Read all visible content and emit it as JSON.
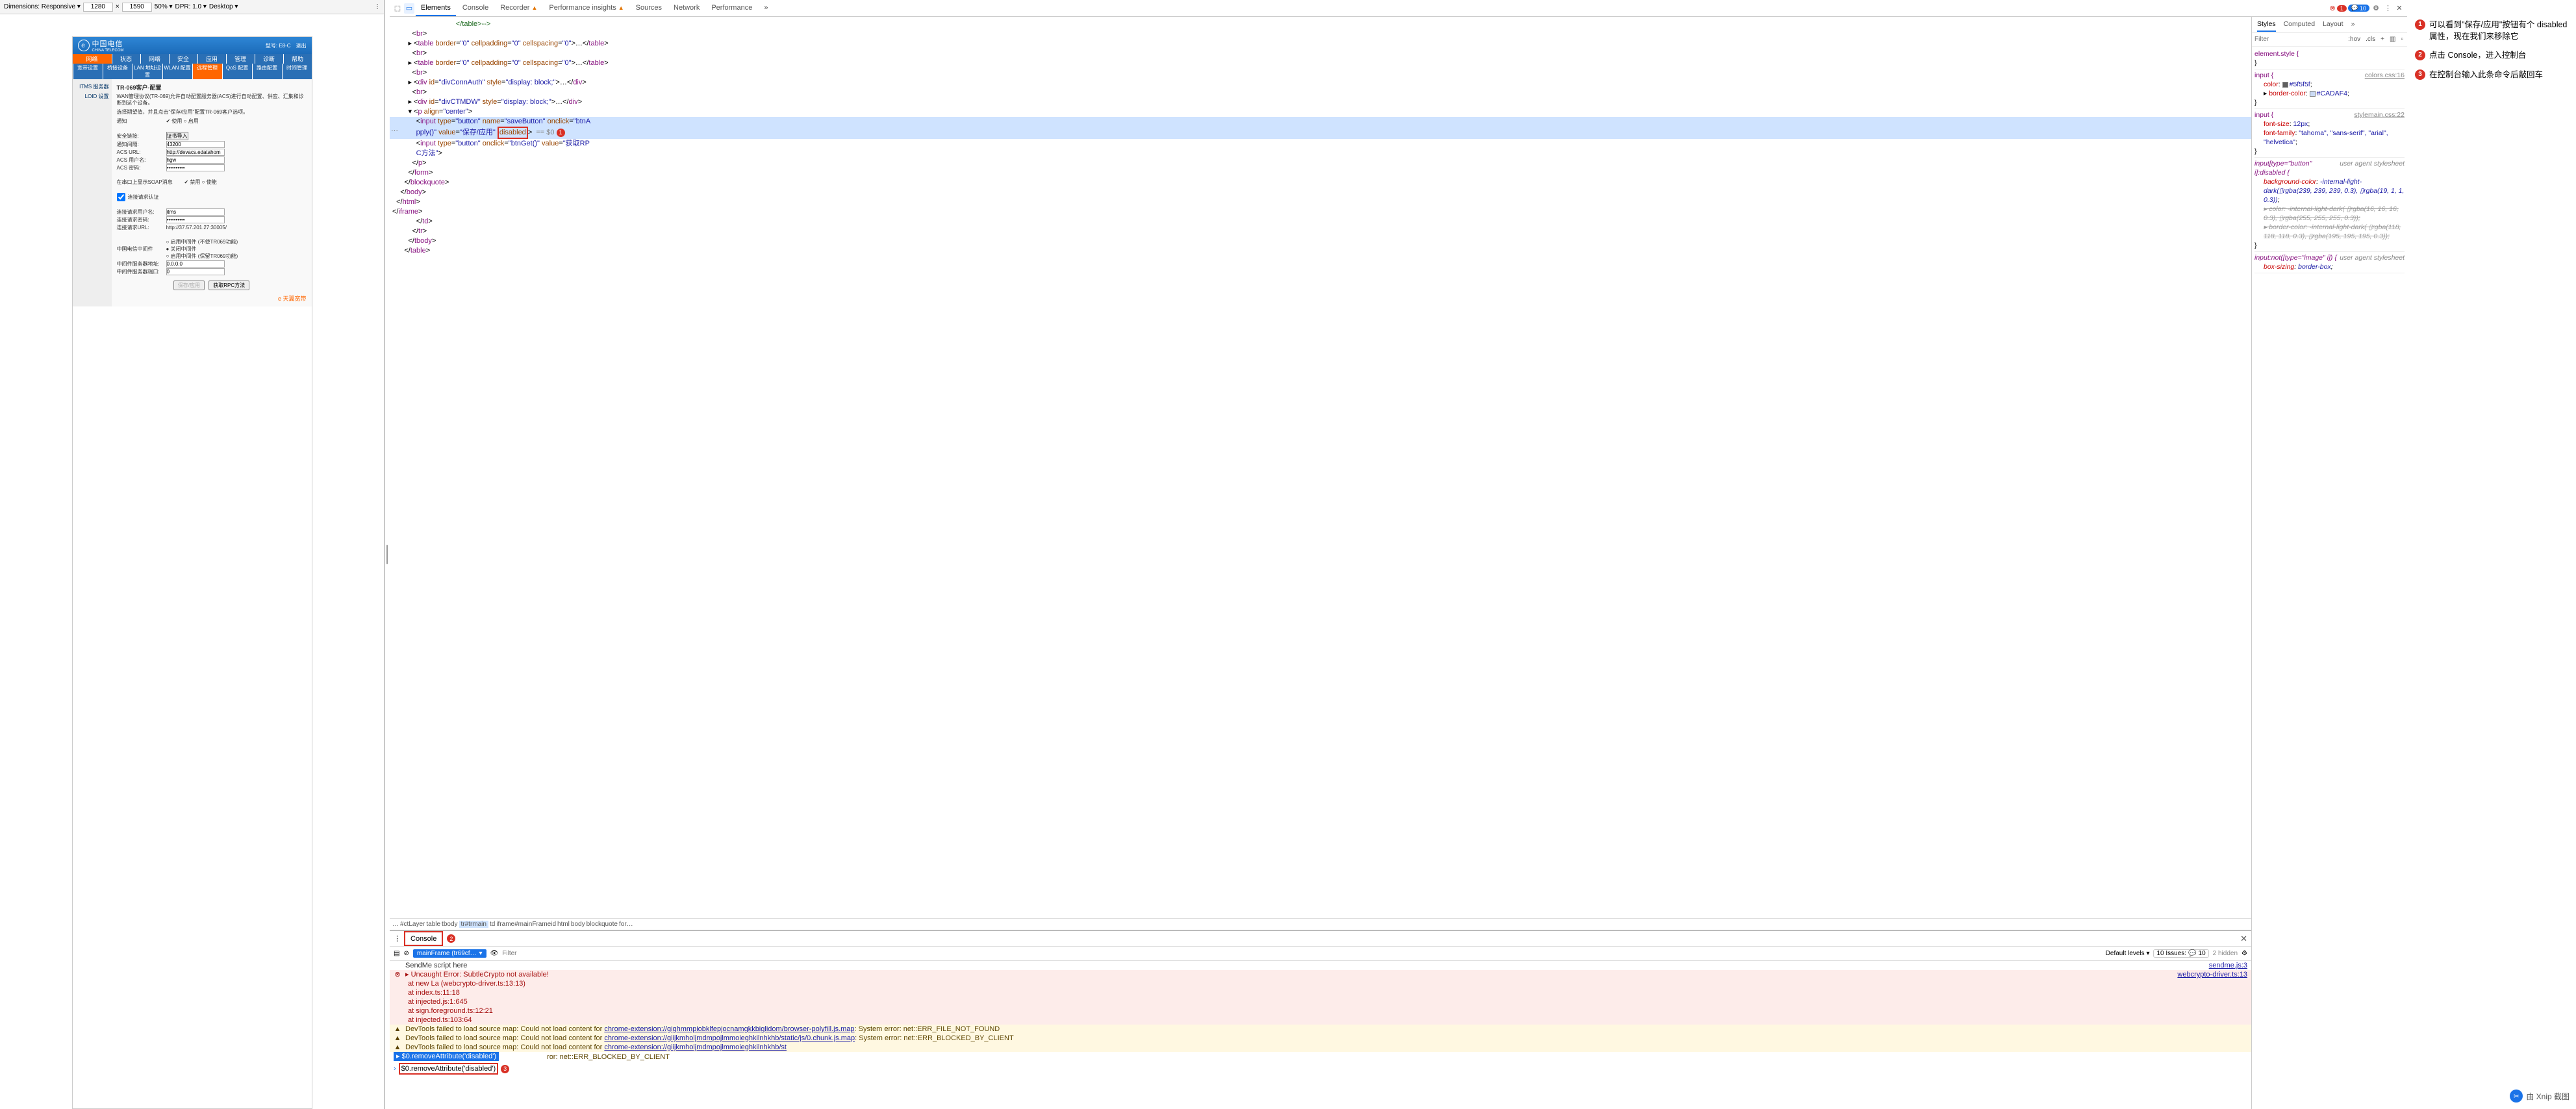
{
  "preview_toolbar": {
    "dimensions_label": "Dimensions: Responsive ▾",
    "width": "1280",
    "times": "×",
    "height": "1590",
    "zoom": "50% ▾",
    "dpr": "DPR: 1.0 ▾",
    "device": "Desktop ▾"
  },
  "router": {
    "logo_text": "中国电信",
    "logo_sub": "CHINA TELECOM",
    "model": "型号: E8-C",
    "logout": "退出",
    "nav1_label": "网络",
    "nav1_items": [
      "状态",
      "网络",
      "安全",
      "应用",
      "管理",
      "诊断",
      "帮助"
    ],
    "nav2_items": [
      "宽带设置",
      "桥接设备",
      "LAN 地址设置",
      "WLAN 配置",
      "远程管理",
      "QoS 配置",
      "路由配置",
      "时间管理"
    ],
    "sidebar": {
      "itms": "ITMS 服务器",
      "loid": "LOID 设置"
    },
    "page_title": "TR-069客户-配置",
    "desc1": "WAN管理协议(TR-069)允许自动配置服务器(ACS)进行自动配置、供应、汇集和诊断到这个设备。",
    "desc2": "选择期望值，并且点击\"保存/应用\"配置TR-069客户选项。",
    "rows": {
      "notify": "通知",
      "enable": "✔ 使用 ○ 启用",
      "sec_label": "安全链接:",
      "sec_value": "证书导入",
      "interval": "通知间隔:",
      "interval_v": "43200",
      "acs_url": "ACS URL:",
      "acs_url_v": "http://devacs.edatahom",
      "acs_user": "ACS 用户名:",
      "acs_user_v": "hgw",
      "acs_pwd": "ACS 密码:",
      "acs_pwd_v": "••••••••••",
      "soap": "在串口上显示SOAP消息",
      "soap_v": "✔ 禁用 ○ 使能",
      "conn_auth": "连接请求认证",
      "conn_user": "连接请求用户名:",
      "conn_user_v": "itms",
      "conn_pwd": "连接请求密码:",
      "conn_pwd_v": "••••••••••",
      "conn_url": "连接请求URL:",
      "conn_url_v": "http://37.57.201.27:30005/",
      "middleware": "中国电信中间件",
      "mw_opt1": "○ 启用中间件 (不使TR069功能)",
      "mw_opt2": "● 关闭中间件",
      "mw_opt3": "○ 启用中间件 (保留TR069功能)",
      "mw_addr": "中间件服务器地址:",
      "mw_addr_v": "0.0.0.0",
      "mw_port": "中间件服务器端口:",
      "mw_port_v": "0"
    },
    "buttons": {
      "save": "保存/应用",
      "rpc": "获取RPC方法"
    },
    "tianyi": "天翼宽带"
  },
  "devtools_tabs": {
    "elements": "Elements",
    "console": "Console",
    "recorder": "Recorder",
    "perf_insights": "Performance insights",
    "sources": "Sources",
    "network": "Network",
    "performance": "Performance",
    "more": "»",
    "errors_count": "1",
    "info_count": "10"
  },
  "elements_tree": {
    "l0": "                </table>-->",
    "l1": "          <br>",
    "l2": "        ▸ <table border=\"0\" cellpadding=\"0\" cellspacing=\"0\">…</table>",
    "l3": "          <br>",
    "l4": "        ▸ <table border=\"0\" cellpadding=\"0\" cellspacing=\"0\">…</table>",
    "l5": "          <br>",
    "l6": "        ▸ <div id=\"divConnAuth\" style=\"display: block;\">…</div>",
    "l7": "          <br>",
    "l8": "        ▸ <div id=\"divCTMDW\" style=\"display: block;\">…</div>",
    "l9": "        ▾ <p align=\"center\">",
    "l10a": "            <input type=\"button\" name=\"saveButton\" onclick=\"btnA",
    "l10b": "            pply()\" value=\"保存/应用\" ",
    "l10c": "disabled",
    "l10d": " == $0",
    "l11": "            <input type=\"button\" onclick=\"btnGet()\" value=\"获取RP",
    "l11b": "            C方法\">",
    "l12": "          </p>",
    "l13": "        </form>",
    "l14": "      </blockquote>",
    "l15": "    </body>",
    "l16": "  </html>",
    "l17": "</iframe>",
    "l18": "            </td>",
    "l19": "          </tr>",
    "l20": "        </tbody>",
    "l21": "      </table>"
  },
  "breadcrumb": [
    "#ctLayer",
    "table",
    "tbody",
    "tr#trmain",
    "td",
    "iframe#mainFrameid",
    "html",
    "body",
    "blockquote",
    "for…"
  ],
  "styles": {
    "tabs": {
      "styles": "Styles",
      "computed": "Computed",
      "layout": "Layout",
      "more": "»"
    },
    "filter_ph": "Filter",
    "hov": ":hov",
    "cls": ".cls",
    "r_elstyle_sel": "element.style {",
    "r_input_sel": "input {",
    "r_input_src": "colors.css:16",
    "r_input_color_n": "color",
    "r_input_color_v": "#5f5f5f",
    "r_input_border_n": "border-color",
    "r_input_border_v": "#CADAF4",
    "r_input2_src": "stylemain.css:22",
    "r_input2_fs_n": "font-size",
    "r_input2_fs_v": "12px",
    "r_input2_ff_n": "font-family",
    "r_input2_ff_v": "\"tahoma\", \"sans-serif\", \"arial\", \"helvetica\"",
    "r_ua1_sel": "input[type=\"button\" i]:disabled {",
    "r_ua_src": "user agent stylesheet",
    "r_ua1_bg_n": "background-color",
    "r_ua1_bg_v": "-internal-light-dark(▯rgba(239, 239, 239, 0.3), ▯rgba(19, 1, 1, 0.3))",
    "r_ua1_color_n": "color",
    "r_ua1_color_v": "-internal-light-dark( ▯rgba(16, 16, 16, 0.3), ▯rgba(255, 255, 255, 0.3))",
    "r_ua1_border_n": "border-color",
    "r_ua1_border_v": "-internal-light-dark( ▯rgba(118, 118, 118, 0.3), ▯rgba(195, 195, 195, 0.3))",
    "r_ua2_sel": "input:not([type=\"image\" i]) {",
    "r_ua2_bs_n": "box-sizing",
    "r_ua2_bs_v": "border-box"
  },
  "drawer": {
    "console_tab": "Console",
    "filter_ph": "Filter",
    "ctx": "mainFrame (tr69cf…",
    "default_levels": "Default levels ▾",
    "issues_label": "10 Issues:",
    "issues_count": "10",
    "hidden": "2 hidden"
  },
  "console": {
    "sendme": "SendMe script here",
    "sendme_src": "sendme.js:3",
    "err_head": "▸ Uncaught Error: SubtleCrypto not available!",
    "err_src": "webcrypto-driver.ts:13",
    "err_s1": "at new La (webcrypto-driver.ts:13:13)",
    "err_s2": "at index.ts:11:18",
    "err_s3": "at injected.js:1:645",
    "err_s4": "at sign.foreground.ts:12:21",
    "err_s5": "at injected.ts:103:64",
    "w1a": "DevTools failed to load source map: Could not load content for ",
    "w1b": "chrome-extension://gighmmpiobklfepjocnamgkkbiglidom/browser-polyfill.js.map",
    "w1c": ": System error: net::ERR_FILE_NOT_FOUND",
    "w2a": "DevTools failed to load source map: Could not load content for ",
    "w2b": "chrome-extension://giijkmholjmdmpojlmmoieghkilnhkhb/static/js/0.chunk.js.map",
    "w2c": ": System error: net::ERR_BLOCKED_BY_CLIENT",
    "w3a": "DevTools failed to load source map: Could not load content for ",
    "w3b": "chrome-extension://giijkmholjmdmpojlmmoieghkilnhkhb/st",
    "w3c": "ror: net::ERR_BLOCKED_BY_CLIENT",
    "hint": "▸ $0.removeAttribute('disabled')",
    "cmd": "$0.removeAttribute('disabled')"
  },
  "annotations": {
    "a1": "可以看到\"保存/应用\"按钮有个 disabled 属性，现在我们来移除它",
    "a2": "点击 Console，进入控制台",
    "a3": "在控制台输入此条命令后敲回车",
    "watermark": "由 Xnip 截图"
  }
}
